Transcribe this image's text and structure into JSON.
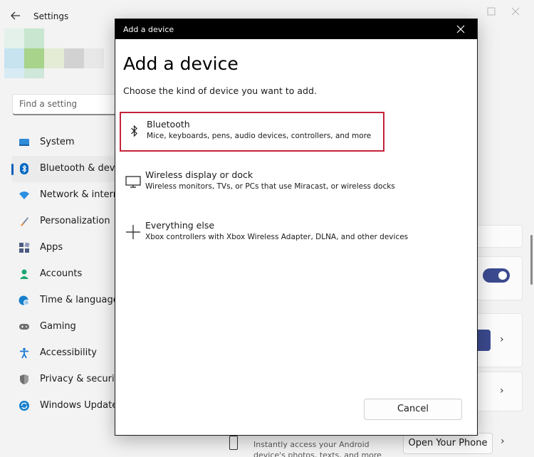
{
  "settings": {
    "app_title": "Settings",
    "search": {
      "placeholder": "Find a setting"
    },
    "nav": [
      {
        "label": "System",
        "icon": "monitor-icon",
        "color": "#0e6fc5"
      },
      {
        "label": "Bluetooth & devices",
        "icon": "bluetooth-icon",
        "color": "#0067c0",
        "active": true
      },
      {
        "label": "Network & internet",
        "icon": "wifi-icon",
        "color": "#1f8fe3"
      },
      {
        "label": "Personalization",
        "icon": "brush-icon",
        "color": "#e07b22"
      },
      {
        "label": "Apps",
        "icon": "apps-icon",
        "color": "#4a5a7a"
      },
      {
        "label": "Accounts",
        "icon": "person-icon",
        "color": "#1ea672"
      },
      {
        "label": "Time & language",
        "icon": "globe-clock-icon",
        "color": "#0e7fc7"
      },
      {
        "label": "Gaming",
        "icon": "gamepad-icon",
        "color": "#6b6b6b"
      },
      {
        "label": "Accessibility",
        "icon": "accessibility-icon",
        "color": "#1778d2"
      },
      {
        "label": "Privacy & security",
        "icon": "shield-icon",
        "color": "#6b6b6b"
      },
      {
        "label": "Windows Update",
        "icon": "update-icon",
        "color": "#0e7fc7"
      }
    ],
    "phone": {
      "description": "Instantly access your Android device's photos, texts, and more",
      "button_label": "Open Your Phone"
    }
  },
  "dialog": {
    "window_title": "Add a device",
    "heading": "Add a device",
    "subtitle": "Choose the kind of device you want to add.",
    "options": [
      {
        "title": "Bluetooth",
        "description": "Mice, keyboards, pens, audio devices, controllers, and more",
        "icon": "bluetooth-icon",
        "highlighted": true
      },
      {
        "title": "Wireless display or dock",
        "description": "Wireless monitors, TVs, or PCs that use Miracast, or wireless docks",
        "icon": "monitor-icon"
      },
      {
        "title": "Everything else",
        "description": "Xbox controllers with Xbox Wireless Adapter, DLNA, and other devices",
        "icon": "plus-icon"
      }
    ],
    "cancel_label": "Cancel"
  },
  "colors": {
    "highlight_border": "#c4223a",
    "accent": "#005fb8",
    "toggle": "#3b4a8f"
  }
}
